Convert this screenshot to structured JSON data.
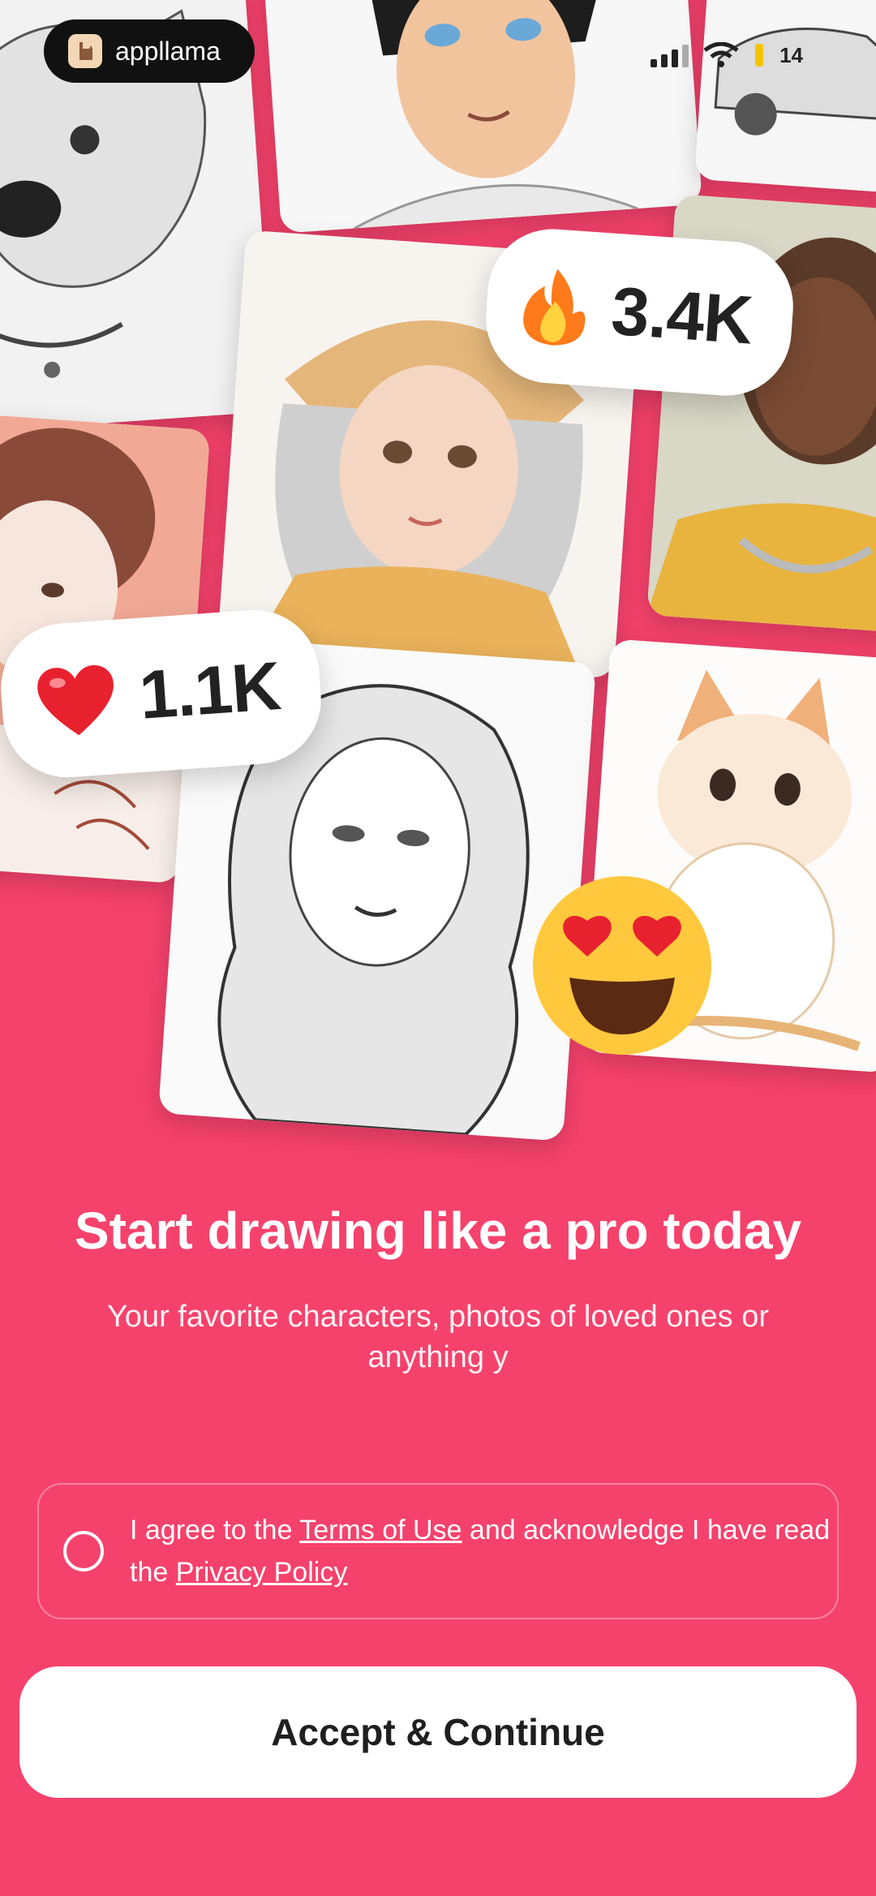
{
  "brand": {
    "name": "appllama",
    "logo_icon": "llama-icon"
  },
  "status_bar": {
    "battery": "14"
  },
  "badges": {
    "fire": {
      "icon": "fire-emoji",
      "value": "3.4K"
    },
    "heart": {
      "icon": "heart-emoji",
      "value": "1.1K"
    },
    "love_eyes": {
      "icon": "heart-eyes-emoji"
    }
  },
  "headline": "Start drawing like a pro today",
  "subheadline": "Your favorite characters, photos of loved ones or anything y",
  "consent": {
    "prefix": "I agree to the ",
    "terms_link": "Terms of Use",
    "middle": " and acknowledge I have read the ",
    "privacy_link": "Privacy Policy"
  },
  "cta_label": "Accept & Continue",
  "colors": {
    "background": "#F5426C",
    "button": "#FFFFFF",
    "button_text": "#1F1F1F"
  }
}
